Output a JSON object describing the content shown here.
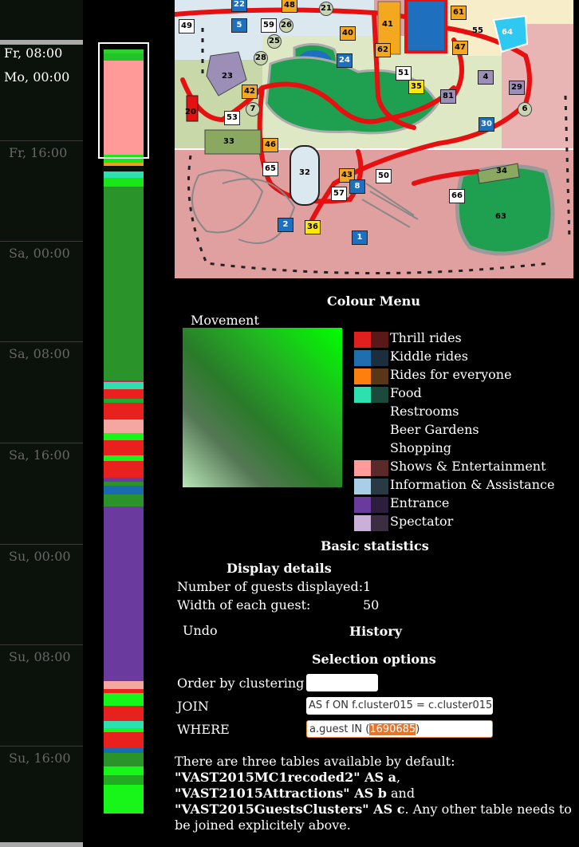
{
  "timeline": {
    "top_labels": [
      "Fr, 08:00",
      "Mo, 00:00"
    ],
    "ticks": [
      "Fr, 16:00",
      "Sa, 00:00",
      "Sa, 08:00",
      "Sa, 16:00",
      "Su, 00:00",
      "Su, 08:00",
      "Su, 16:00"
    ],
    "stripe_colors": [
      "#2ad22a",
      "#22c22a",
      "#ff9a98",
      "#ff9a98",
      "#18e818",
      "#e8a11a",
      "#0b120b",
      "#2ee0b0",
      "#18e818",
      "#2a942a",
      "#2a942a",
      "#2a942a",
      "#c81e6a",
      "#2ee0b0",
      "#e8201e",
      "#22aa33",
      "#e8201e",
      "#f4a6a0",
      "#18f518",
      "#e8201e",
      "#18f518",
      "#e8201e",
      "#6b3a9e",
      "#2a942a",
      "#1a6ab0",
      "#2a942a",
      "#6b3a9e",
      "#6b3a9e",
      "#6b3a9e",
      "#f4a6a0",
      "#e8201e",
      "#18f518",
      "#e8201e",
      "#2ee0b0",
      "#18f518",
      "#e8201e",
      "#1a6ab0",
      "#2a942a",
      "#18f518",
      "#22aa22",
      "#18f518"
    ]
  },
  "map": {
    "attraction_numbers": [
      "22",
      "48",
      "21",
      "61",
      "55",
      "49",
      "5",
      "59",
      "26",
      "40",
      "41",
      "64",
      "25",
      "28",
      "24",
      "62",
      "47",
      "23",
      "42",
      "51",
      "35",
      "4",
      "29",
      "81",
      "7",
      "6",
      "20",
      "53",
      "30",
      "33",
      "46",
      "32",
      "65",
      "43",
      "50",
      "34",
      "57",
      "8",
      "66",
      "63",
      "2",
      "36",
      "1"
    ]
  },
  "colour_menu": {
    "title": "Colour Menu",
    "movement_label": "Movement",
    "legend": [
      {
        "label": "Thrill rides",
        "color": "#e0201e",
        "dark": "#5a1818"
      },
      {
        "label": "Kiddle rides",
        "color": "#1f6fae",
        "dark": "#1c2e3e"
      },
      {
        "label": "Rides for everyone",
        "color": "#ff7f0e",
        "dark": "#5a3618"
      },
      {
        "label": "Food",
        "color": "#2ee0b0",
        "dark": "#1b4a3c"
      },
      {
        "label": "Restrooms",
        "color": "",
        "dark": ""
      },
      {
        "label": "Beer Gardens",
        "color": "",
        "dark": ""
      },
      {
        "label": "Shopping",
        "color": "",
        "dark": ""
      },
      {
        "label": "Shows & Entertainment",
        "color": "#ff9c9a",
        "dark": "#5a2a2a"
      },
      {
        "label": "Information & Assistance",
        "color": "#a8cfe6",
        "dark": "#2a3a44"
      },
      {
        "label": "Entrance",
        "color": "#6b3a9e",
        "dark": "#2e1e3e"
      },
      {
        "label": "Spectator",
        "color": "#c8b0d8",
        "dark": "#3a2e40"
      }
    ]
  },
  "stats": {
    "title": "Basic statistics",
    "display_details_title": "Display details",
    "guests_label": "Number of guests displayed:",
    "guests_value": "1",
    "width_label": "Width of each guest:",
    "width_value": "50"
  },
  "controls": {
    "undo_label": "Undo",
    "history_label": "History"
  },
  "selection": {
    "title": "Selection options",
    "order_label": "Order by clustering",
    "order_value": "",
    "join_label": "JOIN",
    "join_value": "AS f ON f.cluster015 = c.cluster015",
    "where_label": "WHERE",
    "where_prefix": "a.guest IN (",
    "where_selected": "1690685",
    "where_suffix": ")"
  },
  "footer": {
    "intro": "There are three tables available by default:",
    "t1": "\"VAST2015MC1recoded2\" AS a",
    "sep1": ",",
    "t2": "\"VAST21015Attractions\" AS b",
    "and": " and",
    "t3": "\"VAST2015GuestsClusters\" AS c",
    "outro": ". Any other table needs to be joined explicitely above."
  }
}
